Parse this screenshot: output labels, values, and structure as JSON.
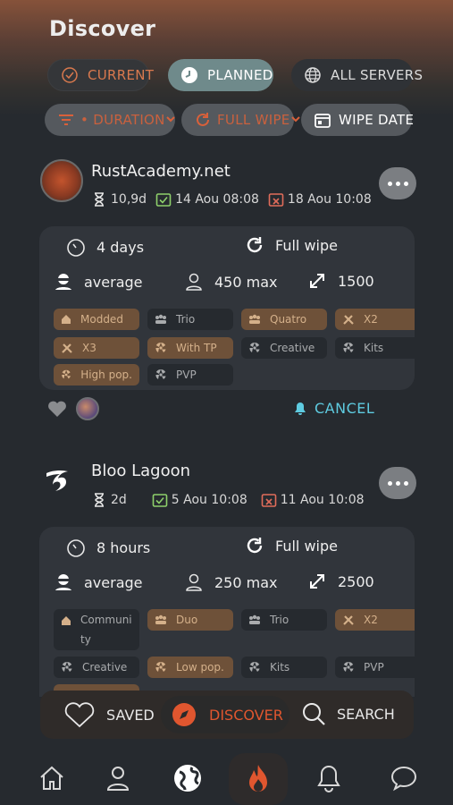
{
  "page": {
    "title": "Discover"
  },
  "filters": {
    "row1": [
      {
        "label": "CURRENT",
        "icon": "check-circle-icon"
      },
      {
        "label": "PLANNED",
        "icon": "clock-icon"
      },
      {
        "label": "ALL SERVERS",
        "icon": "globe-icon"
      }
    ],
    "row2": [
      {
        "label": "• DURATION",
        "icon": "filter-icon"
      },
      {
        "label": "FULL WIPE",
        "icon": "refresh-icon"
      },
      {
        "label": "WIPE DATE",
        "icon": "calendar-icon"
      }
    ]
  },
  "servers": [
    {
      "name": "RustAcademy.net",
      "duration": "10,9d",
      "start": "14 Aou 08:08",
      "end": "18 Aou 10:08",
      "wipe_time": "4 days",
      "wipe_type": "Full wipe",
      "level": "average",
      "max_players": "450 max",
      "map_size": "1500",
      "tags": [
        "Modded",
        "Trio",
        "Quatro",
        "X2",
        "X3",
        "With TP",
        "Creative",
        "Kits",
        "High pop.",
        "PVP"
      ],
      "action": "CANCEL"
    },
    {
      "name": "Bloo Lagoon",
      "duration": "2d",
      "start": "5 Aou 10:08",
      "end": "11 Aou 10:08",
      "wipe_time": "8 hours",
      "wipe_type": "Full wipe",
      "level": "average",
      "max_players": "250 max",
      "map_size": "2500",
      "tags": [
        "Communi\nty",
        "Duo",
        "Trio",
        "X2",
        "Creative",
        "Low pop.",
        "Kits",
        "PVP"
      ]
    }
  ],
  "bottom_bar": {
    "saved": "SAVED",
    "discover": "DISCOVER",
    "search": "SEARCH"
  },
  "nav": [
    "home-icon",
    "profile-icon",
    "globe-icon",
    "fire-icon",
    "bell-icon",
    "chat-icon"
  ],
  "colors": {
    "accent": "#e0562f",
    "tag_highlight": "#6e5139",
    "cancel": "#5ecbe0",
    "panel": "#31353b"
  }
}
